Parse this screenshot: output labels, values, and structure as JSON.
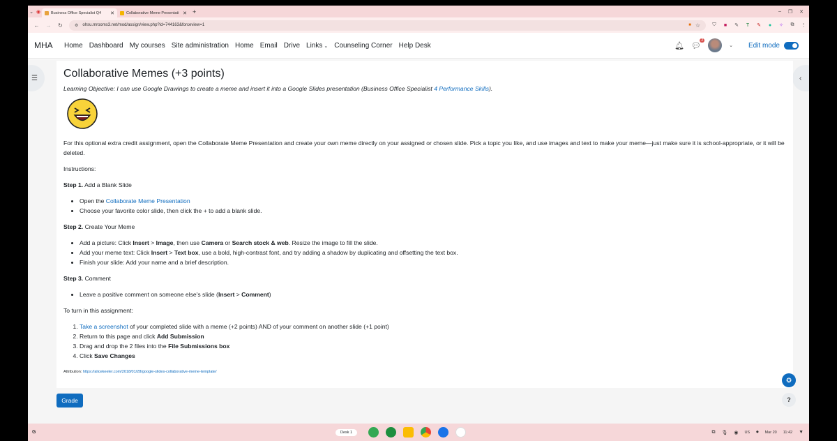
{
  "browser": {
    "tabs": [
      {
        "title": "Business Office Specialist Q4",
        "favicon_color": "#e8a33d"
      },
      {
        "title": "Collaborative Meme Presentati",
        "favicon_color": "#f4b400"
      }
    ],
    "new_tab": "+",
    "url": "ohsu.mrooms3.net/mod/assign/view.php?id=744163&forceview=1"
  },
  "site_nav": {
    "brand": "MHA",
    "links": [
      "Home",
      "Dashboard",
      "My courses",
      "Site administration",
      "Home",
      "Email",
      "Drive",
      "Links",
      "Counseling Corner",
      "Help Desk"
    ],
    "message_badge": "2",
    "edit_mode_label": "Edit mode"
  },
  "assignment": {
    "title": "Collaborative Memes (+3 points)",
    "objective_prefix": "Learning Objective: I can use Google Drawings to create a meme and insert it into a Google Slides presentation (Business Office Specialist ",
    "objective_link": "4 Performance Skills",
    "objective_suffix": ").",
    "intro": "For this optional extra credit assignment, open the Collaborate Meme Presentation and create your own meme directly on your assigned or chosen slide. Pick a topic you like, and use images and text to make your meme—just make sure it is school-appropriate, or it will be deleted.",
    "instructions_label": "Instructions:",
    "step1": {
      "label": "Step 1.",
      "title": "Add a Blank Slide",
      "item1_prefix": "Open the ",
      "item1_link": "Collaborate Meme Presentation",
      "item2": "Choose your favorite color slide, then click the + to add a blank slide."
    },
    "step2": {
      "label": "Step 2.",
      "title": "Create Your Meme",
      "i1": [
        "Add a picture: Click ",
        "Insert",
        " > ",
        "Image",
        ", then use ",
        "Camera",
        " or ",
        "Search stock & web",
        ". Resize the image to fill the slide."
      ],
      "i2": [
        "Add your meme text: Click ",
        "Insert",
        " > ",
        "Text box",
        ", use a bold, high-contrast font, and try adding a shadow by duplicating and offsetting the text box."
      ],
      "i3": "Finish your slide: Add your name and a brief description."
    },
    "step3": {
      "label": "Step 3.",
      "title": "Comment",
      "i1": [
        "Leave a positive comment on someone else's slide (",
        "Insert",
        " > ",
        "Comment",
        ")"
      ]
    },
    "turn_in": {
      "label": "To turn in this assignment:",
      "i1_link": "Take a screenshot",
      "i1_rest": " of your completed slide with a meme (+2 points) AND of your comment on another slide (+1 point)",
      "i2_prefix": "Return to this page and click ",
      "i2_bold": "Add Submission",
      "i3_prefix": "Drag and drop the 2 files into the ",
      "i3_bold": "File Submissions box",
      "i4_prefix": "Click ",
      "i4_bold": "Save Changes"
    },
    "attribution_label": "Attribution: ",
    "attribution_link": "https://alicekeeler.com/2018/01/28/google-slides-collaborative-meme-template/",
    "grade_button": "Grade",
    "help_button": "?"
  },
  "shelf": {
    "desk_label": "Desk 1",
    "region": "US",
    "date": "Mar 20",
    "time": "11:42",
    "app_colors": [
      "#34a853",
      "#1e8e3e",
      "#fbbc04",
      "#ea4335",
      "#1a73e8",
      "#ffffff"
    ]
  },
  "colors": {
    "accent": "#0f6cbf",
    "chrome_bar": "#f6d7d9"
  }
}
